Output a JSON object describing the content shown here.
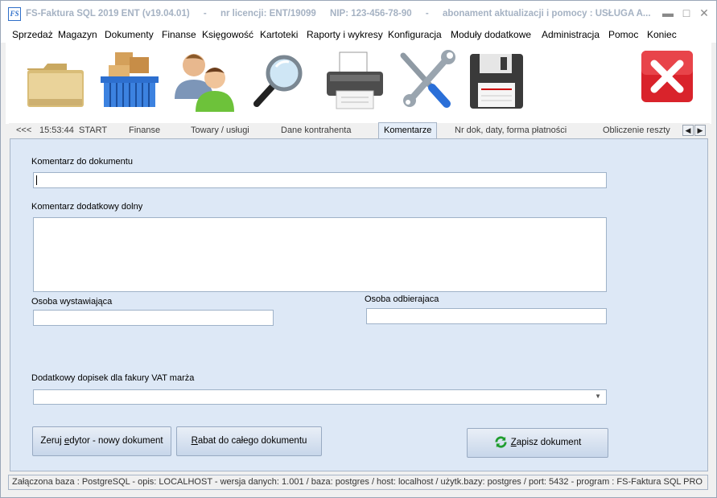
{
  "titlebar": {
    "app_icon_text": "FS",
    "segments": [
      "FS-Faktura SQL 2019 ENT (v19.04.01)",
      "-",
      "nr licencji: ENT/19099",
      "NIP: 123-456-78-90",
      "-",
      "abonament aktualizacji i pomocy : USŁUGA A..."
    ],
    "minimize": "▬",
    "maximize": "□",
    "close": "✕"
  },
  "menu": [
    "Sprzedaż",
    "Magazyn",
    "Dokumenty",
    "Finanse",
    "Księgowość",
    "Kartoteki",
    "Raporty i wykresy",
    "Konfiguracja",
    "Moduły dodatkowe",
    "Administracja",
    "Pomoc",
    "Koniec"
  ],
  "toolbar": {
    "icons": [
      "folder-icon",
      "basket-icon",
      "contacts-icon",
      "magnifier-icon",
      "printer-icon",
      "tools-icon",
      "floppy-disk-icon",
      "close-red-icon"
    ]
  },
  "tabs": {
    "prev": "<<<",
    "time": "15:53:44",
    "start": "START",
    "items": [
      "Finanse",
      "Towary  / usługi",
      "Dane kontrahenta",
      "Komentarze",
      "Nr dok, daty, forma płatności",
      "Obliczenie reszty"
    ],
    "active": "Komentarze",
    "scroll_left": "◀",
    "scroll_right": "▶"
  },
  "form": {
    "comment_label": "Komentarz do dokumentu",
    "comment_value": "",
    "extra_comment_label": "Komentarz dodatkowy dolny",
    "extra_comment_value": "",
    "issuer_label": "Osoba wystawiająca",
    "issuer_value": "",
    "receiver_label": "Osoba odbierajaca",
    "receiver_value": "",
    "vat_margin_label": "Dodatkowy dopisek dla fakury VAT marża",
    "vat_margin_value": ""
  },
  "buttons": {
    "reset_prefix": "Zeruj ",
    "reset_underlined": "e",
    "reset_suffix": "dytor -  nowy dokument",
    "discount_underlined": "R",
    "discount_suffix": "abat do całego dokumentu",
    "save_underlined": "Z",
    "save_suffix": "apisz dokument"
  },
  "status": "Załączona baza : PostgreSQL - opis: LOCALHOST - wersja danych: 1.001  / baza: postgres / host: localhost / użytk.bazy: postgres /  port: 5432  -  program :  FS-Faktura SQL PRO",
  "colors": {
    "panel_bg": "#dde8f6",
    "title_text": "#a5b2c3",
    "close_red": "#d9232b"
  }
}
